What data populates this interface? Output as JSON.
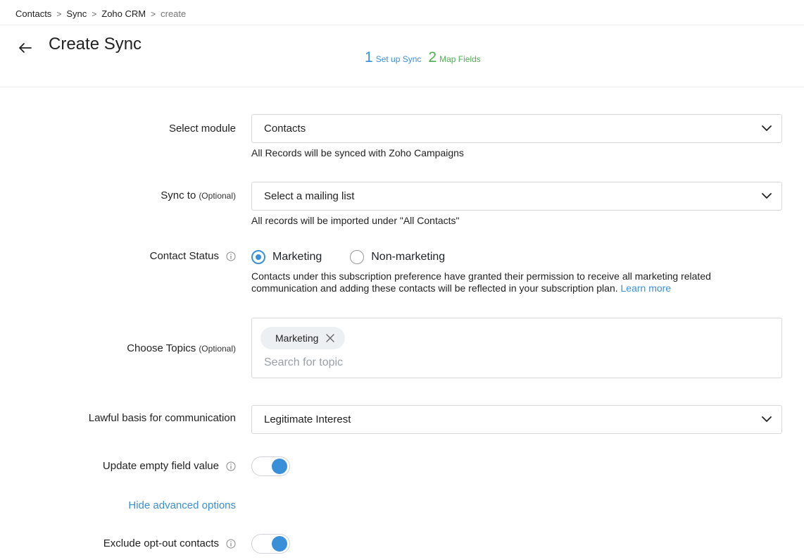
{
  "breadcrumb": {
    "items": [
      "Contacts",
      "Sync",
      "Zoho CRM"
    ],
    "current": "create",
    "separator": ">"
  },
  "header": {
    "title": "Create Sync"
  },
  "stepper": {
    "steps": [
      {
        "num": "1",
        "label": "Set up Sync"
      },
      {
        "num": "2",
        "label": "Map Fields"
      }
    ]
  },
  "form": {
    "module": {
      "label": "Select module",
      "value": "Contacts",
      "hint": "All Records will be synced with Zoho Campaigns"
    },
    "sync_to": {
      "label": "Sync to",
      "optional": "(Optional)",
      "value": "Select a mailing list",
      "hint": "All records will be imported under \"All Contacts\""
    },
    "contact_status": {
      "label": "Contact Status",
      "options": [
        "Marketing",
        "Non-marketing"
      ],
      "selected": "Marketing",
      "description": "Contacts under this subscription preference have granted their permission to receive all marketing related communication and adding these contacts will be reflected in your subscription plan.",
      "learn_more": "Learn more"
    },
    "topics": {
      "label": "Choose Topics",
      "optional": "(Optional)",
      "chips": [
        "Marketing"
      ],
      "placeholder": "Search for topic"
    },
    "lawful_basis": {
      "label": "Lawful basis for communication",
      "value": "Legitimate Interest"
    },
    "update_empty": {
      "label": "Update empty field value",
      "on": true
    },
    "advanced_link": "Hide advanced options",
    "exclude_optout": {
      "label": "Exclude opt-out contacts",
      "on": true
    }
  },
  "colors": {
    "accent": "#3a8fd9",
    "step2": "#4caf50",
    "border": "#d6d9dc",
    "chip_bg": "#edf0f3"
  },
  "icons": {
    "back": "arrow-left-icon",
    "dropdown": "chevron-down-icon",
    "info": "info-icon",
    "remove": "close-icon"
  }
}
